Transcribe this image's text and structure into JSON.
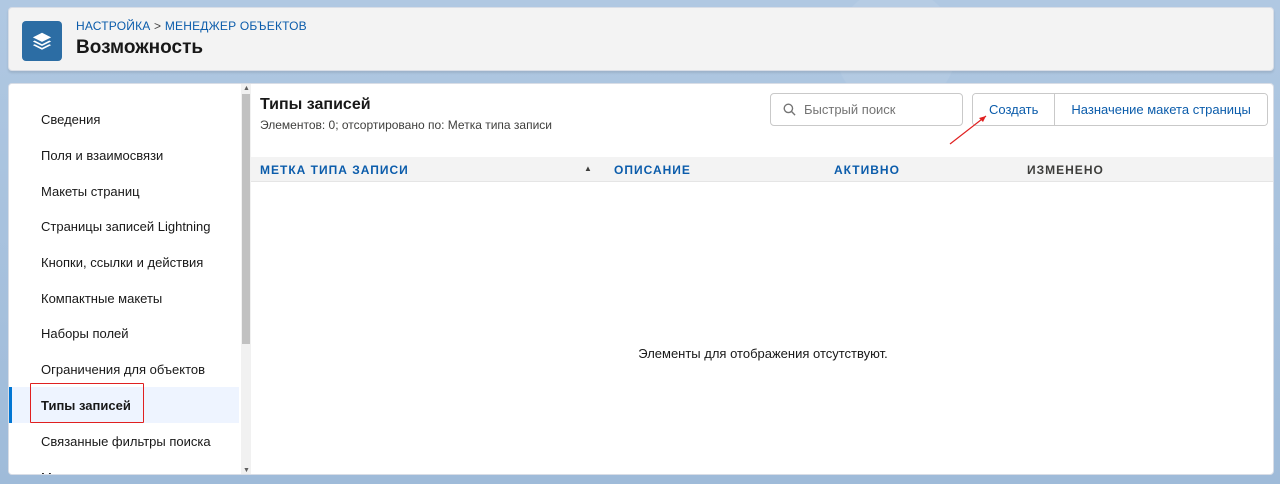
{
  "header": {
    "breadcrumb": [
      "НАСТРОЙКА",
      ">",
      "МЕНЕДЖЕР ОБЪЕКТОВ"
    ],
    "title": "Возможность",
    "icon": "layers-icon",
    "icon_color": "#2c6da4"
  },
  "sidebar": {
    "items": [
      {
        "label": "Сведения"
      },
      {
        "label": "Поля и взаимосвязи"
      },
      {
        "label": "Макеты страниц"
      },
      {
        "label": "Страницы записей Lightning"
      },
      {
        "label": "Кнопки, ссылки и действия"
      },
      {
        "label": "Компактные макеты"
      },
      {
        "label": "Наборы полей"
      },
      {
        "label": "Ограничения для объектов"
      },
      {
        "label": "Типы записей",
        "active": true
      },
      {
        "label": "Связанные фильтры поиска"
      },
      {
        "label": "Макеты поиска"
      }
    ]
  },
  "main": {
    "title": "Типы записей",
    "subtitle": "Элементов: 0; отсортировано по: Метка типа записи",
    "search_placeholder": "Быстрый поиск",
    "buttons": {
      "create": "Создать",
      "page_layout_assignment": "Назначение макета страницы"
    },
    "columns": [
      "МЕТКА ТИПА ЗАПИСИ",
      "ОПИСАНИЕ",
      "АКТИВНО",
      "ИЗМЕНЕНО"
    ],
    "sort_indicator": "▲",
    "empty_message": "Элементы для отображения отсутствуют."
  },
  "colors": {
    "link": "#0b5cab",
    "annotation": "#e02020",
    "active_nav_bg": "#eef4ff"
  }
}
